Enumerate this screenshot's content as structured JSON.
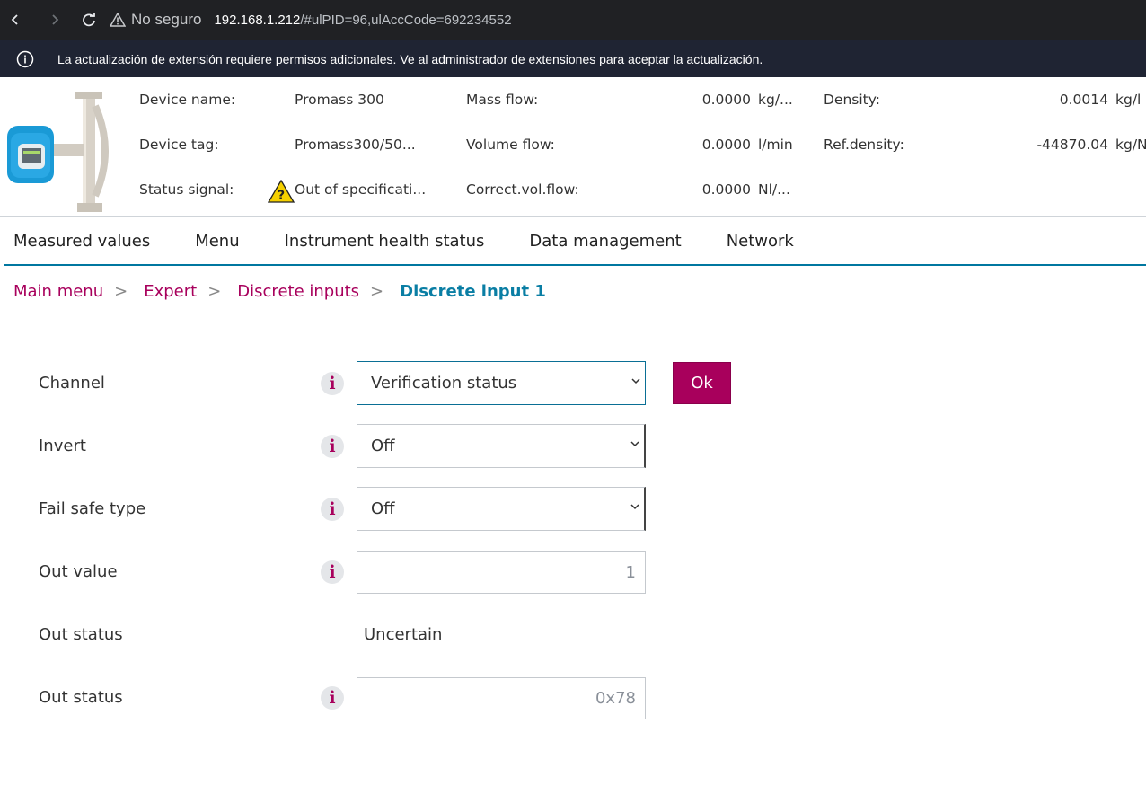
{
  "browser": {
    "security_label": "No seguro",
    "url_host": "192.168.1.212",
    "url_rest": "/#ulPID=96,ulAccCode=692234552"
  },
  "infobar": {
    "message": "La actualización de extensión requiere permisos adicionales. Ve al administrador de extensiones para aceptar la actualización."
  },
  "device": {
    "name_label": "Device name:",
    "name_value": "Promass 300",
    "tag_label": "Device tag:",
    "tag_value": "Promass300/50...",
    "status_label": "Status signal:",
    "status_value": "Out of specificati...",
    "mass_flow_label": "Mass flow:",
    "mass_flow_value": "0.0000",
    "mass_flow_unit": "kg/...",
    "volume_flow_label": "Volume flow:",
    "volume_flow_value": "0.0000",
    "volume_flow_unit": "l/min",
    "corr_vol_flow_label": "Correct.vol.flow:",
    "corr_vol_flow_value": "0.0000",
    "corr_vol_flow_unit": "Nl/...",
    "density_label": "Density:",
    "density_value": "0.0014",
    "density_unit": "kg/l",
    "ref_density_label": "Ref.density:",
    "ref_density_value": "-44870.04",
    "ref_density_unit": "kg/N"
  },
  "nav": {
    "items": [
      "Measured values",
      "Menu",
      "Instrument health status",
      "Data management",
      "Network"
    ]
  },
  "breadcrumb": {
    "items": [
      "Main menu",
      "Expert",
      "Discrete inputs"
    ],
    "current": "Discrete input 1",
    "separator": ">"
  },
  "form": {
    "channel": {
      "label": "Channel",
      "value": "Verification status"
    },
    "invert": {
      "label": "Invert",
      "value": "Off"
    },
    "fail_safe": {
      "label": "Fail safe type",
      "value": "Off"
    },
    "out_value": {
      "label": "Out value",
      "value": "1"
    },
    "out_status_text": {
      "label": "Out status",
      "value": "Uncertain"
    },
    "out_status_code": {
      "label": "Out status",
      "value": "0x78"
    },
    "ok_label": "Ok",
    "info_glyph": "i"
  },
  "colors": {
    "accent": "#a8005c",
    "link_current": "#0a7ea4",
    "nav_underline": "#0077a0",
    "browser_bg": "#202124",
    "infobar_bg": "#1f2433"
  }
}
